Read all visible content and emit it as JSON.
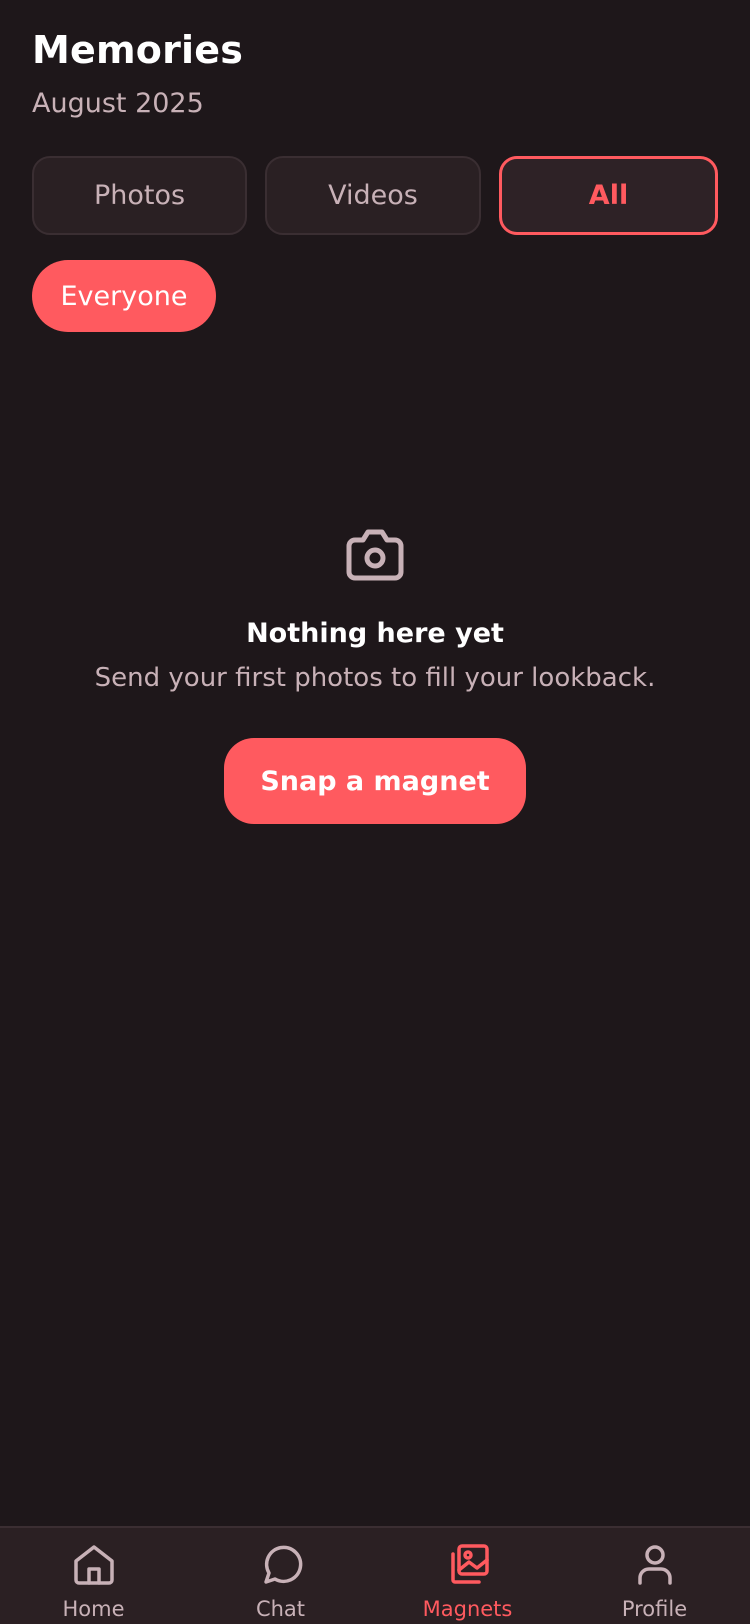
{
  "header": {
    "title": "Memories",
    "subtitle": "August 2025"
  },
  "filters": {
    "tabs": [
      {
        "label": "Photos",
        "active": false
      },
      {
        "label": "Videos",
        "active": false
      },
      {
        "label": "All",
        "active": true
      }
    ],
    "people_chip": "Everyone"
  },
  "empty_state": {
    "icon": "camera-icon",
    "title": "Nothing here yet",
    "message": "Send your first photos to fill your lookback.",
    "action_label": "Snap a magnet"
  },
  "bottom_nav": {
    "items": [
      {
        "label": "Home",
        "icon": "home-icon",
        "active": false
      },
      {
        "label": "Chat",
        "icon": "chat-bubble-icon",
        "active": false
      },
      {
        "label": "Magnets",
        "icon": "photo-gallery-icon",
        "active": true
      },
      {
        "label": "Profile",
        "icon": "person-icon",
        "active": false
      }
    ]
  },
  "colors": {
    "background": "#1e171a",
    "accent": "#ff5a5f",
    "muted_text": "#c8b1b7",
    "surface": "#2a2023"
  }
}
